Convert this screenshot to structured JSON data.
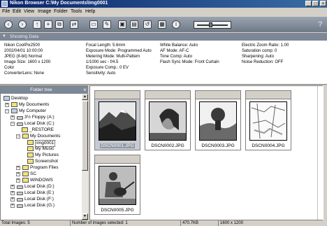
{
  "window": {
    "title": "Nikon Browser C:\\My Documents\\Img0001",
    "minimize": "_",
    "maximize": "□",
    "close": "×"
  },
  "menu": [
    "File",
    "Edit",
    "View",
    "Image",
    "Folder",
    "Tools",
    "Help"
  ],
  "toolbar": {
    "help": "?",
    "zoom_level": 0.45
  },
  "shooting_data": {
    "label": "Shooting Data",
    "col1": [
      "Nikon CoolPix2500",
      "2002/04/01 10:00:00",
      "JPEG (8-bit) Normal",
      "Image Size: 1600 x 1200",
      "Color",
      "ConverterLens: None"
    ],
    "col2": [
      "Focal Length: 5.6mm",
      "Exposure Mode: Programmed Auto",
      "Metering Mode: Multi-Pattern",
      "1/1000 sec - f/4.5",
      "Exposure Comp.: 0 EV",
      "Sensitivity: Auto"
    ],
    "col3": [
      "White Balance: Auto",
      "AF Mode: AF-C",
      "Tone Comp: Auto",
      "Flash Sync Mode: Front Curtain"
    ],
    "col4": [
      "Electric Zoom Ratio: 1.00",
      "Saturation comp: 0",
      "Sharpening: Auto",
      "Noise Reduction: OFF"
    ]
  },
  "folder_tree": {
    "header": "Folder tree",
    "close": "×",
    "items": [
      {
        "label": "Desktop"
      },
      {
        "label": "My Documents"
      },
      {
        "label": "My Computer"
      },
      {
        "label": "3½ Floppy (A:)"
      },
      {
        "label": "Local Disk (C:)"
      },
      {
        "label": "_RESTORE"
      },
      {
        "label": "My Documents"
      },
      {
        "label": "Img0001"
      },
      {
        "label": "My Music"
      },
      {
        "label": "My Pictures"
      },
      {
        "label": "Screenshot"
      },
      {
        "label": "Program Files"
      },
      {
        "label": "SC"
      },
      {
        "label": "WINDOWS"
      },
      {
        "label": "Local Disk (D:)"
      },
      {
        "label": "Local Disk (E:)"
      },
      {
        "label": "Local Disk (F:)"
      },
      {
        "label": "Local Disk (G:)"
      }
    ]
  },
  "thumbnails": [
    {
      "filename": "DSCN0001.JPG",
      "selected": true
    },
    {
      "filename": "DSCN0002.JPG",
      "selected": false
    },
    {
      "filename": "DSCN0003.JPG",
      "selected": false
    },
    {
      "filename": "DSCN0004.JPG",
      "selected": false
    },
    {
      "filename": "DSCN0005.JPG",
      "selected": false
    }
  ],
  "status": {
    "total": "Total Images: 5",
    "selected": "Number of images selected: 1",
    "size": "470.7KB",
    "dimensions": "1600 x 1200"
  }
}
